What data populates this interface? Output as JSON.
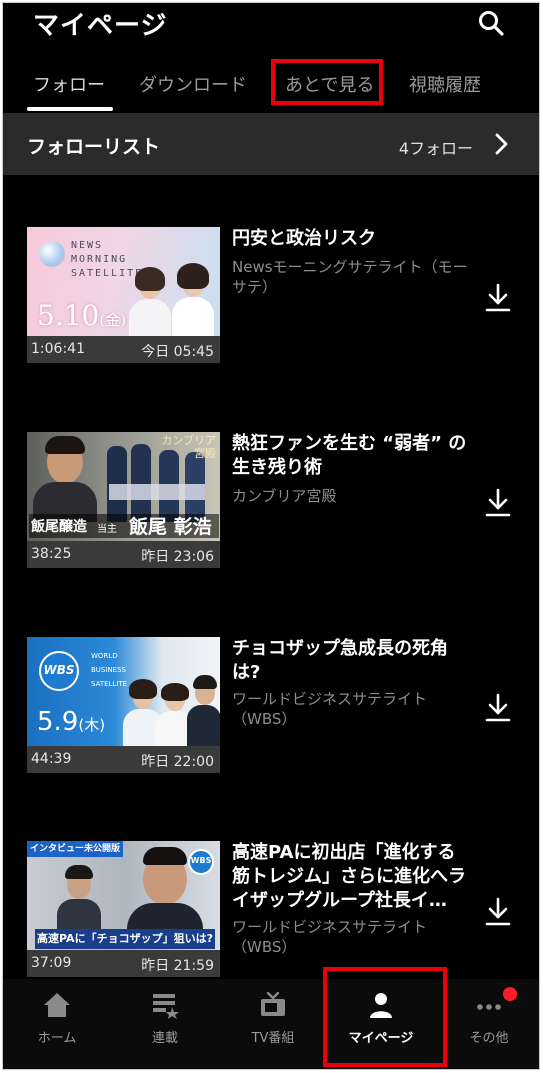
{
  "header": {
    "title": "マイページ"
  },
  "tabs": [
    {
      "label": "フォロー"
    },
    {
      "label": "ダウンロード"
    },
    {
      "label": "あとで見る"
    },
    {
      "label": "視聴履歴"
    }
  ],
  "follow": {
    "title": "フォローリスト",
    "count": "4フォロー"
  },
  "items": [
    {
      "title": "円安と政治リスク",
      "channel": "Newsモーニングサテライト（モーサテ）",
      "duration": "1:06:41",
      "date": "今日 05:45",
      "thumb": {
        "logo_text": "NEWS MORNING SATELLITE",
        "date_text": "5.10",
        "day_text": "(金)"
      }
    },
    {
      "title": "熱狂ファンを生む “弱者” の生き残り術",
      "channel": "カンブリア宮殿",
      "duration": "38:25",
      "date": "昨日 23:06",
      "thumb": {
        "caption_left": "飯尾醸造",
        "caption_role": "当主",
        "caption_name": "飯尾 彰浩",
        "corner_text": "カンブリア宮殿"
      }
    },
    {
      "title": "チョコザップ急成長の死角は?",
      "channel": "ワールドビジネスサテライト（WBS）",
      "duration": "44:39",
      "date": "昨日 22:00",
      "thumb": {
        "logo_text": "WBS",
        "sub_text": "WORLD BUSINESS SATELLITE",
        "date_text": "5.9",
        "day_text": "(木)"
      }
    },
    {
      "title": "高速PAに初出店「進化する筋トレジム」さらに進化へライザップグループ社長イ…",
      "channel": "ワールドビジネスサテライト（WBS）",
      "duration": "37:09",
      "date": "昨日 21:59",
      "thumb": {
        "badge_text": "インタビュー未公開版",
        "logo_text": "WBS",
        "caption_text": "高速PAに「チョコザップ」狙いは?"
      }
    }
  ],
  "bottom_nav": [
    {
      "label": "ホーム",
      "icon": "home-icon"
    },
    {
      "label": "連載",
      "icon": "series-icon"
    },
    {
      "label": "TV番組",
      "icon": "tv-icon"
    },
    {
      "label": "マイページ",
      "icon": "person-icon"
    },
    {
      "label": "その他",
      "icon": "more-icon"
    }
  ],
  "colors": {
    "highlight": "#e8000b",
    "background": "#000000",
    "notification": "#ff1a2a"
  }
}
